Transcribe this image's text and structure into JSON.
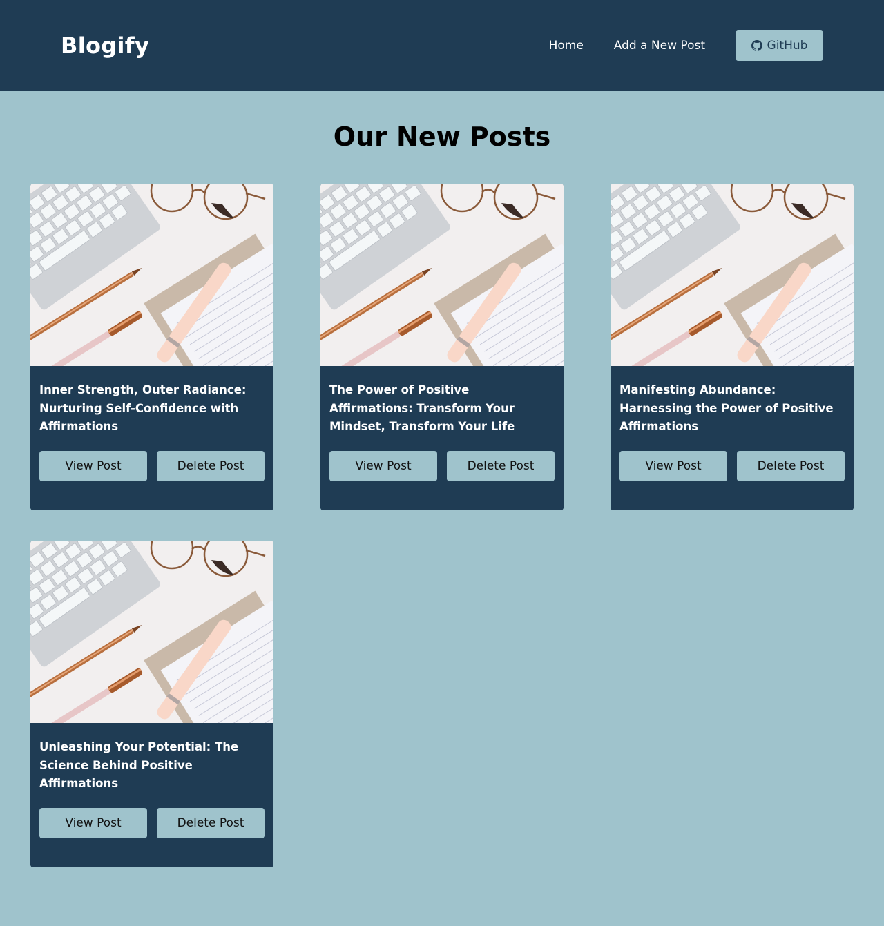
{
  "navbar": {
    "brand": "Blogify",
    "links": [
      "Home",
      "Add a New Post"
    ],
    "github_label": "GitHub",
    "icon": "github-icon"
  },
  "main": {
    "heading": "Our New Posts",
    "posts": [
      {
        "title": "Inner Strength, Outer Radiance: Nurturing Self-Confidence with Affirmations",
        "view_label": "View Post",
        "delete_label": "Delete Post"
      },
      {
        "title": "The Power of Positive Affirmations: Transform Your Mindset, Transform Your Life",
        "view_label": "View Post",
        "delete_label": "Delete Post"
      },
      {
        "title": "Manifesting Abundance: Harnessing the Power of Positive Affirmations",
        "view_label": "View Post",
        "delete_label": "Delete Post"
      },
      {
        "title": "Unleashing Your Potential: The Science Behind Positive Affirmations",
        "view_label": "View Post",
        "delete_label": "Delete Post"
      }
    ]
  },
  "colors": {
    "navbar_bg": "#1f3c54",
    "page_bg": "#9fc3cc",
    "card_bg": "#1f3c54",
    "button_bg": "#9fc3cc"
  }
}
